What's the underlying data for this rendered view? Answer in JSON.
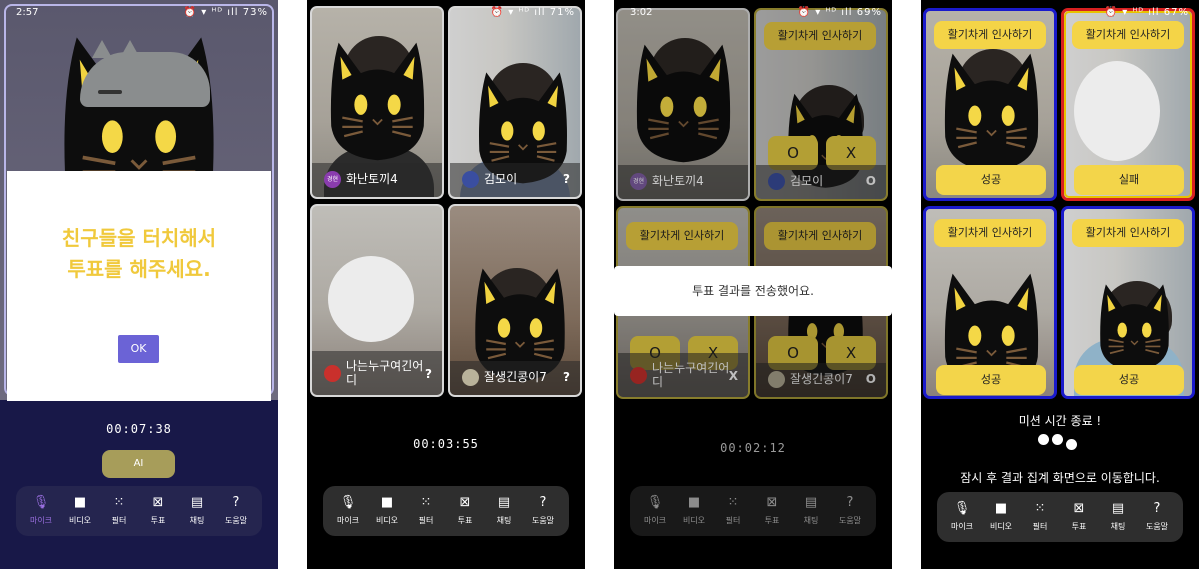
{
  "toolbar_items": [
    {
      "icon": "mic-icon",
      "glyph": "🎤",
      "label": "마이크"
    },
    {
      "icon": "video-icon",
      "glyph": "■",
      "label": "비디오"
    },
    {
      "icon": "filter-icon",
      "glyph": "⁙",
      "label": "필터"
    },
    {
      "icon": "vote-icon",
      "glyph": "⊠",
      "label": "투표"
    },
    {
      "icon": "chat-icon",
      "glyph": "▤",
      "label": "채팅"
    },
    {
      "icon": "help-icon",
      "glyph": "?",
      "label": "도움말"
    }
  ],
  "screen1": {
    "status": {
      "time": "2:57",
      "battery": "73%"
    },
    "dialog": {
      "message": "친구들을 터치해서 투표를 해주세요.",
      "ok_label": "OK"
    },
    "timer": "00:07:38",
    "ai_label": "AI",
    "mic_muted": true
  },
  "screen2": {
    "timer": "00:03:55",
    "participants": [
      {
        "avatar_text": "경현",
        "name": "화난토끼4",
        "mark": ""
      },
      {
        "avatar_text": "",
        "name": "김모이",
        "mark": "?"
      },
      {
        "avatar_text": "",
        "name": "나는누구여긴어디",
        "mark": "?"
      },
      {
        "avatar_text": "",
        "name": "잘생긴콩이7",
        "mark": "?"
      }
    ]
  },
  "screen3": {
    "status": {
      "time": "3:02",
      "battery": "69%"
    },
    "mission": "활기차게 인사하기",
    "o_label": "O",
    "x_label": "X",
    "toast": "투표 결과를 전송했어요.",
    "timer": "00:02:12",
    "participants": [
      {
        "avatar_text": "경현",
        "name": "화난토끼4",
        "mark": ""
      },
      {
        "avatar_text": "",
        "name": "김모이",
        "mark": "O"
      },
      {
        "avatar_text": "",
        "name": "나는누구여긴어디",
        "mark": "X"
      },
      {
        "avatar_text": "",
        "name": "잘생긴콩이7",
        "mark": "O"
      }
    ]
  },
  "screen4": {
    "status": {
      "battery": "67%"
    },
    "mission": "활기차게 인사하기",
    "results": [
      "성공",
      "실패",
      "성공",
      "성공"
    ],
    "end_text": "미션 시간 종료 !",
    "moving_text": "잠시 후 결과 집계 화면으로 이동합니다."
  },
  "colors": {
    "accent": "#f4d447",
    "dialog_text": "#f0c93c",
    "ok_button": "#6b63d6",
    "success_border": "#1a1acc",
    "fail_border": "#d82020"
  }
}
